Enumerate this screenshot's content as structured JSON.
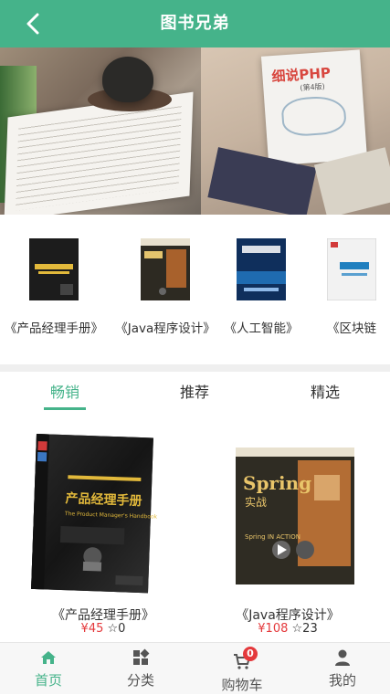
{
  "header": {
    "title": "图书兄弟",
    "back_icon": "chevron-left-icon"
  },
  "banner": {
    "images": [
      "reading-desk-photo",
      "php-book-photo"
    ],
    "php_book_cover": "细说PHP",
    "php_book_edition": "(第4版)"
  },
  "featured_books": [
    {
      "label": "《产品经理手册》"
    },
    {
      "label": "《Java程序设计》"
    },
    {
      "label": "《人工智能》"
    },
    {
      "label": "《区块链"
    }
  ],
  "tabs": [
    {
      "label": "畅销",
      "active": true
    },
    {
      "label": "推荐",
      "active": false
    },
    {
      "label": "精选",
      "active": false
    }
  ],
  "products": [
    {
      "name": "《产品经理手册》",
      "price": "¥45",
      "stars": "☆0",
      "cover_title": "产品经理手册",
      "cover_subtitle": "The Product Manager's Handbook"
    },
    {
      "name": "《Java程序设计》",
      "price": "¥108",
      "stars": "☆23",
      "cover_title": "Spring",
      "cover_subtitle": "实战",
      "cover_en": "Spring IN ACTION"
    }
  ],
  "tabbar": [
    {
      "label": "首页",
      "icon": "home-icon",
      "active": true
    },
    {
      "label": "分类",
      "icon": "category-icon",
      "active": false
    },
    {
      "label": "购物车",
      "icon": "cart-icon",
      "active": false,
      "badge": "0"
    },
    {
      "label": "我的",
      "icon": "user-icon",
      "active": false
    }
  ],
  "colors": {
    "accent": "#45b38a",
    "price": "#e4393c",
    "badge": "#e4393c"
  }
}
